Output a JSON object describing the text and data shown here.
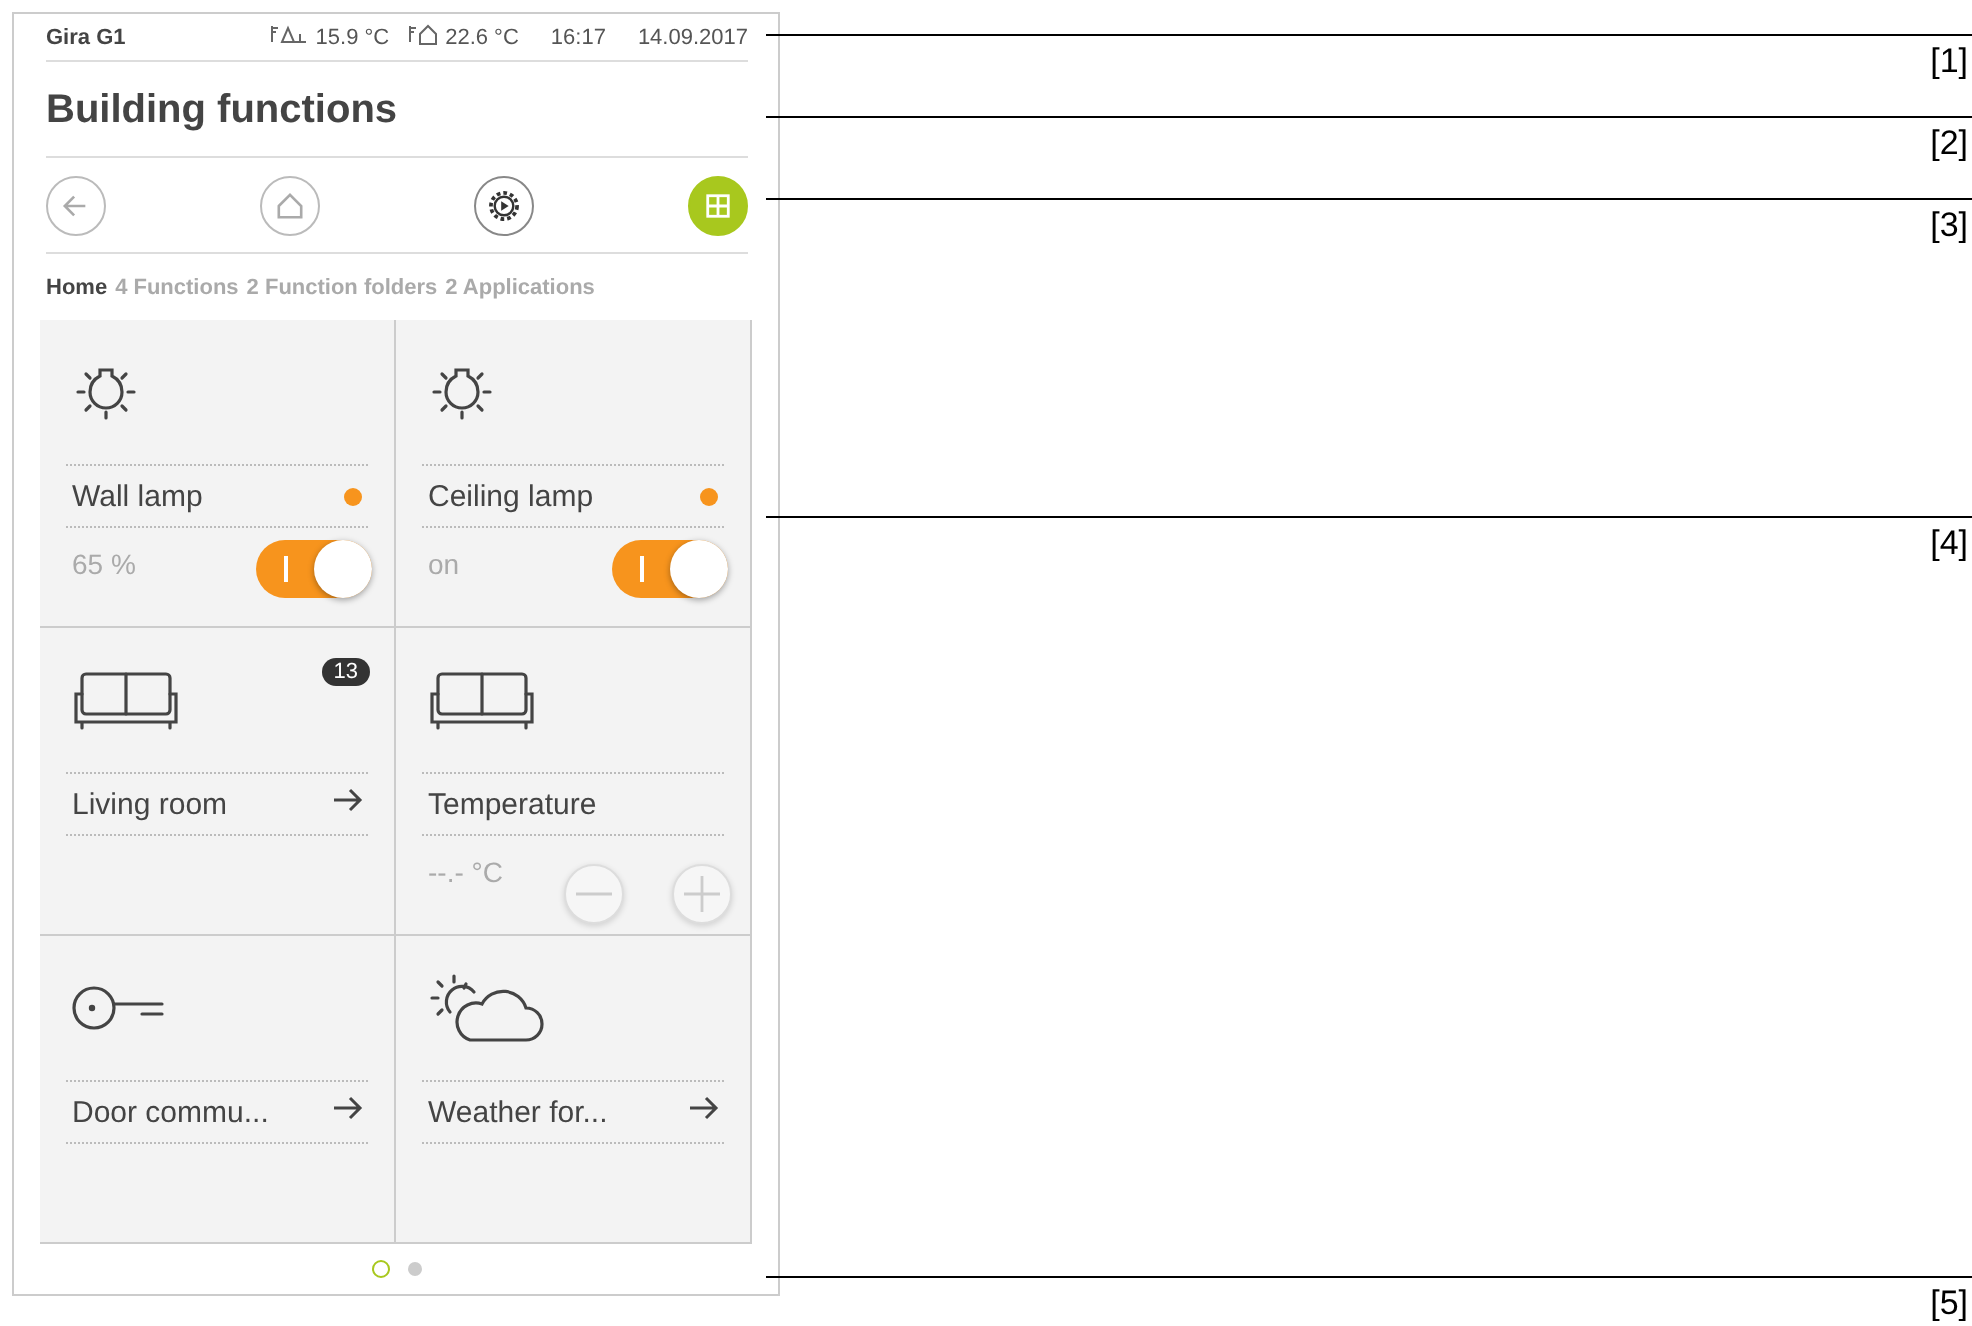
{
  "status_bar": {
    "device": "Gira G1",
    "outdoor_temp": "15.9 °C",
    "indoor_temp": "22.6 °C",
    "time": "16:17",
    "date": "14.09.2017"
  },
  "title": "Building functions",
  "nav_buttons": [
    {
      "kind": "back",
      "selected": false
    },
    {
      "kind": "home",
      "selected": false
    },
    {
      "kind": "settings",
      "selected": false
    },
    {
      "kind": "grid",
      "selected": true
    }
  ],
  "breadcrumb": [
    {
      "label": "Home",
      "selected": true
    },
    {
      "label": "4 Functions",
      "selected": false
    },
    {
      "label": "2 Function folders",
      "selected": false
    },
    {
      "label": "2 Applications",
      "selected": false
    }
  ],
  "tiles": [
    {
      "kind": "lamp",
      "name": "Wall lamp",
      "value": "65 %",
      "on": true
    },
    {
      "kind": "lamp",
      "name": "Ceiling lamp",
      "value": "on",
      "on": true
    },
    {
      "kind": "room",
      "name": "Living room",
      "badge": "13"
    },
    {
      "kind": "temperature",
      "name": "Temperature",
      "value": "--.- °C"
    },
    {
      "kind": "door",
      "name": "Door commu..."
    },
    {
      "kind": "weather",
      "name": "Weather for..."
    }
  ],
  "pages": [
    {
      "selected": true
    },
    {
      "selected": false
    }
  ],
  "callouts": [
    "[1]",
    "[2]",
    "[3]",
    "[4]",
    "[5]"
  ]
}
